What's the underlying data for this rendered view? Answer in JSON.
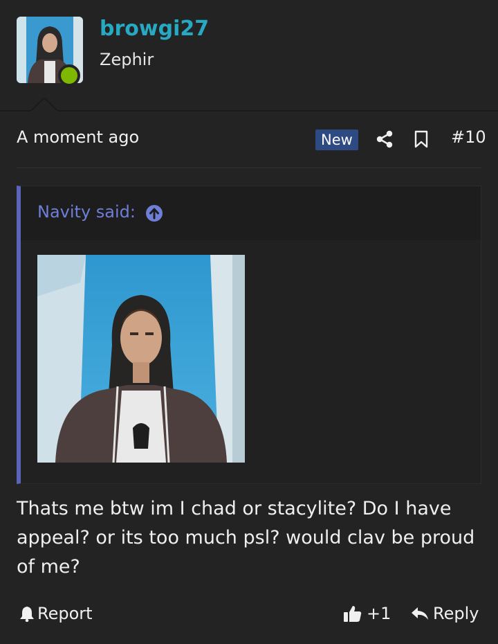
{
  "user": {
    "username": "browgi27",
    "title": "Zephir",
    "online": true
  },
  "post": {
    "timestamp": "A moment ago",
    "badge": "New",
    "number": "#10",
    "body": "Thats me btw im I chad or stacylite? Do I have appeal? or its too much psl? would clav be proud of me?"
  },
  "quote": {
    "author_label": "Navity said:"
  },
  "actions": {
    "report_label": "Report",
    "like_label": "+1",
    "reply_label": "Reply"
  },
  "colors": {
    "background": "#232323",
    "username": "#27a9c4",
    "online": "#7fb800",
    "badge": "#2e4a82",
    "quote_accent": "#5a64b8"
  },
  "icons": {
    "share": "share-icon",
    "bookmark": "bookmark-icon",
    "quote_jump": "arrow-up-circle-icon",
    "report": "bell-icon",
    "like": "thumbs-up-icon",
    "reply": "reply-arrow-icon"
  }
}
